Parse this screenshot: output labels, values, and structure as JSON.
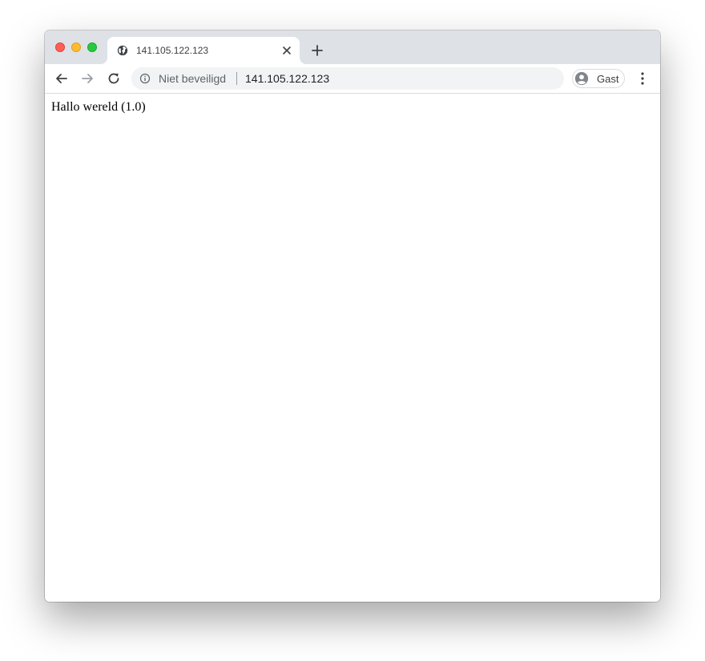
{
  "browser": {
    "tab": {
      "title": "141.105.122.123",
      "favicon": "globe-icon",
      "close_icon": "close-icon"
    },
    "new_tab_icon": "plus-icon",
    "toolbar": {
      "back_icon": "arrow-left-icon",
      "forward_icon": "arrow-right-icon",
      "reload_icon": "reload-icon",
      "menu_icon": "more-vertical-icon"
    },
    "omnibox": {
      "security_icon": "info-icon",
      "security_label": "Niet beveiligd",
      "url": "141.105.122.123"
    },
    "profile": {
      "icon": "person-icon",
      "label": "Gast"
    }
  },
  "page": {
    "text": "Hallo wereld (1.0)"
  },
  "colors": {
    "titlebar": "#dee1e6",
    "omnibox": "#f1f3f4",
    "traffic_close": "#ff5f57",
    "traffic_minimize": "#febc2e",
    "traffic_maximize": "#28c840"
  }
}
